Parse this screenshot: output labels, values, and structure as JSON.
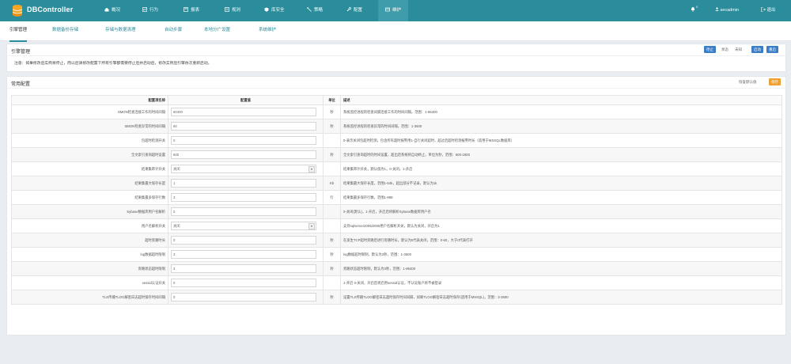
{
  "app": {
    "title": "DBController"
  },
  "nav": [
    {
      "label": "概况",
      "icon": "home-icon"
    },
    {
      "label": "行为",
      "icon": "activity-icon"
    },
    {
      "label": "报表",
      "icon": "report-icon"
    },
    {
      "label": "规则",
      "icon": "rules-icon"
    },
    {
      "label": "库安全",
      "icon": "shield-icon"
    },
    {
      "label": "策略",
      "icon": "policy-icon"
    },
    {
      "label": "配置",
      "icon": "wrench-icon"
    },
    {
      "label": "维护",
      "icon": "maintain-icon"
    }
  ],
  "topright": {
    "notify_count": "0",
    "user": "secadmin",
    "logout": "退出"
  },
  "subtabs": [
    "引擎管理",
    "数据备份存储",
    "存储与数据清理",
    "自动步骤",
    "本地分广设置",
    "系统维护"
  ],
  "engine_panel": {
    "title": "引擎管理",
    "buttons": {
      "stop": "停止",
      "state": "状态",
      "restart": "未知",
      "btn1": "启动",
      "btn2": "重启"
    },
    "notice": "注意：如果修改后实例将停止，而以后请修改配置下所有引擎都需要停止后并启动后，修改实例后引擎依次重新启动。"
  },
  "config_panel": {
    "title": "常用配置",
    "restore_default": "恢复默认值",
    "save": "保存",
    "columns": [
      "配置项名称",
      "配置值",
      "单位",
      "描述"
    ],
    "rows": [
      {
        "name": "SMON检查连接工作的时间间隔",
        "value": "60400",
        "select": false,
        "unit": "秒",
        "desc": "系统监控进程的检查间隔连接工作的时间间隔，范围：1-86400"
      },
      {
        "name": "SMON检查异常的时间间隔",
        "value": "60",
        "select": false,
        "unit": "秒",
        "desc": "系统监控进程的检查异常的时间间隔，范围：1-3600"
      },
      {
        "name": "包超时检测开关",
        "value": "0",
        "select": false,
        "unit": "",
        "desc": "0-表示关闭包超时检测，包含所有超时报警用1-自行关闭超时，超过后超时检测报警时长（适用于MSSQL数据库）"
      },
      {
        "name": "全文索引查询超时设置",
        "value": "600",
        "select": false,
        "unit": "秒",
        "desc": "全文索引查询超时的时间设置，超出后系统将自动终止，单位为秒，范围：600-1800"
      },
      {
        "name": "结果集审计开关",
        "value": "关闭",
        "select": true,
        "unit": "",
        "desc": "结果集审计开关，默认值为1，0-关闭，1-开启"
      },
      {
        "name": "结果集最大保存长度",
        "value": "1",
        "select": false,
        "unit": "Kb",
        "desc": "结果集最大保存长度，范围1-64k，超出部分不记录，默认为1k"
      },
      {
        "name": "结果集最多保存行数",
        "value": "3",
        "select": false,
        "unit": "行",
        "desc": "结果集最多保存行数，范围1-999"
      },
      {
        "name": "Sybase数据库用户名解析",
        "value": "0",
        "select": false,
        "unit": "",
        "desc": "0-关闭(默认)，1-开启，开启后将解析Sybase数据库用户名"
      },
      {
        "name": "用户名解析开关",
        "value": "关闭",
        "select": true,
        "unit": "",
        "desc": "支持sqlserver2005/2008用户名解析开关，默认为关闭，开启为1"
      },
      {
        "name": "超时旁路时长",
        "value": "0",
        "select": false,
        "unit": "秒",
        "desc": "在发生TCP超时旁路后进行旁路时长，默认为0代表关闭，范围：0-60，大于0代表打开"
      },
      {
        "name": "log数据超时限制",
        "value": "3",
        "select": false,
        "unit": "秒",
        "desc": "log数据超时限制，默认为3秒，范围：1-3600"
      },
      {
        "name": "旁路状态超时限制",
        "value": "3",
        "select": false,
        "unit": "秒",
        "desc": "旁路状态超时限制，默认为3秒，范围：1-86400"
      },
      {
        "name": "sessid认证开关",
        "value": "0",
        "select": false,
        "unit": "",
        "desc": "1-开启 0-关闭，开启后将启用sessid认证，不认证账户将不被登录"
      },
      {
        "name": "TLS传输TLOG解密日志超时保存时间间隔",
        "value": "0",
        "select": false,
        "unit": "秒",
        "desc": "设置TLS传输TLOG解密日志超时保存时间间隔，如果TLOG解密日志超时保存(适用于MSSQL)，范围：3-3600"
      }
    ]
  }
}
